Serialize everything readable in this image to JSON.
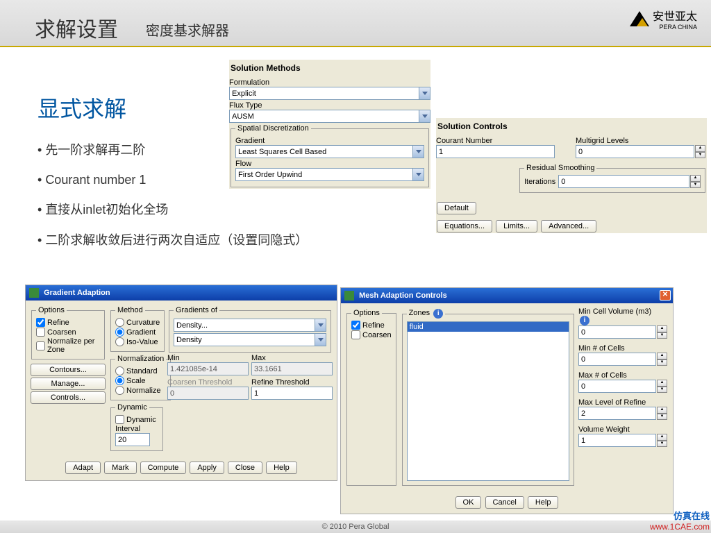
{
  "header": {
    "title_main": "求解设置",
    "title_sub": "密度基求解器",
    "logo_cn": "安世亚太",
    "logo_en": "PERA CHINA"
  },
  "section": {
    "heading": "显式求解",
    "bullets": [
      "先一阶求解再二阶",
      "Courant number 1",
      "直接从inlet初始化全场",
      "二阶求解收敛后进行两次自适应（设置同隐式）"
    ]
  },
  "sol_methods": {
    "title": "Solution Methods",
    "formulation_lbl": "Formulation",
    "formulation_val": "Explicit",
    "flux_lbl": "Flux Type",
    "flux_val": "AUSM",
    "spatial_legend": "Spatial Discretization",
    "gradient_lbl": "Gradient",
    "gradient_val": "Least Squares Cell Based",
    "flow_lbl": "Flow",
    "flow_val": "First Order Upwind"
  },
  "sol_controls": {
    "title": "Solution Controls",
    "courant_lbl": "Courant Number",
    "courant_val": "1",
    "multigrid_lbl": "Multigrid Levels",
    "multigrid_val": "0",
    "resid_legend": "Residual Smoothing",
    "iter_lbl": "Iterations",
    "iter_val": "0",
    "btn_default": "Default",
    "btn_eq": "Equations...",
    "btn_limits": "Limits...",
    "btn_adv": "Advanced..."
  },
  "grad_adapt": {
    "title": "Gradient Adaption",
    "options_legend": "Options",
    "opt_refine": "Refine",
    "opt_coarsen": "Coarsen",
    "opt_norm": "Normalize per Zone",
    "method_legend": "Method",
    "m_curv": "Curvature",
    "m_grad": "Gradient",
    "m_iso": "Iso-Value",
    "norm_legend": "Normalization",
    "n_std": "Standard",
    "n_scale": "Scale",
    "n_norm": "Normalize",
    "grads_legend": "Gradients of",
    "grads_val1": "Density...",
    "grads_val2": "Density",
    "min_lbl": "Min",
    "min_val": "1.421085e-14",
    "max_lbl": "Max",
    "max_val": "33.1661",
    "cth_lbl": "Coarsen Threshold",
    "cth_val": "0",
    "rth_lbl": "Refine Threshold",
    "rth_val": "1",
    "dyn_legend": "Dynamic",
    "dyn_chk": "Dynamic",
    "dyn_int_lbl": "Interval",
    "dyn_int_val": "20",
    "btn_contours": "Contours...",
    "btn_manage": "Manage...",
    "btn_controls": "Controls...",
    "btn_adapt": "Adapt",
    "btn_mark": "Mark",
    "btn_compute": "Compute",
    "btn_apply": "Apply",
    "btn_close": "Close",
    "btn_help": "Help"
  },
  "mesh_adapt": {
    "title": "Mesh Adaption Controls",
    "options_legend": "Options",
    "opt_refine": "Refine",
    "opt_coarsen": "Coarsen",
    "zones_legend": "Zones",
    "zone_sel": "fluid",
    "mincell_lbl": "Min Cell Volume (m3)",
    "mincell_val": "0",
    "minnum_lbl": "Min # of Cells",
    "minnum_val": "0",
    "maxnum_lbl": "Max # of Cells",
    "maxnum_val": "0",
    "maxlvl_lbl": "Max Level of Refine",
    "maxlvl_val": "2",
    "volw_lbl": "Volume Weight",
    "volw_val": "1",
    "btn_ok": "OK",
    "btn_cancel": "Cancel",
    "btn_help": "Help"
  },
  "footer": {
    "copyright": "© 2010 Pera Global",
    "wm_cn": "仿真在线",
    "wm_en": "www.1CAE.com"
  }
}
